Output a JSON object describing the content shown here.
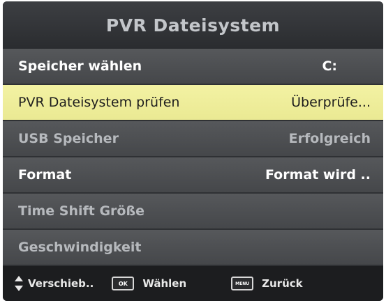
{
  "title": "PVR Dateisystem",
  "rows": [
    {
      "label": "Speicher wählen",
      "value": "C:"
    },
    {
      "label": "PVR Dateisystem prüfen",
      "value": "Überprüfe..."
    },
    {
      "label": "USB Speicher",
      "value": "Erfolgreich"
    },
    {
      "label": "Format",
      "value": "Format wird .."
    },
    {
      "label": "Time Shift Größe",
      "value": ""
    },
    {
      "label": "Geschwindigkeit",
      "value": ""
    }
  ],
  "footer": {
    "move": {
      "icon": "updown-arrows-icon",
      "label": "Verschieb.."
    },
    "ok": {
      "key": "OK",
      "label": "Wählen"
    },
    "menu": {
      "key": "MENU",
      "label": "Zurück"
    }
  },
  "colors": {
    "background": "#2f3134",
    "row": "#4e5053",
    "selected_row": "#f0efa0",
    "footer": "#1c1d1f"
  }
}
